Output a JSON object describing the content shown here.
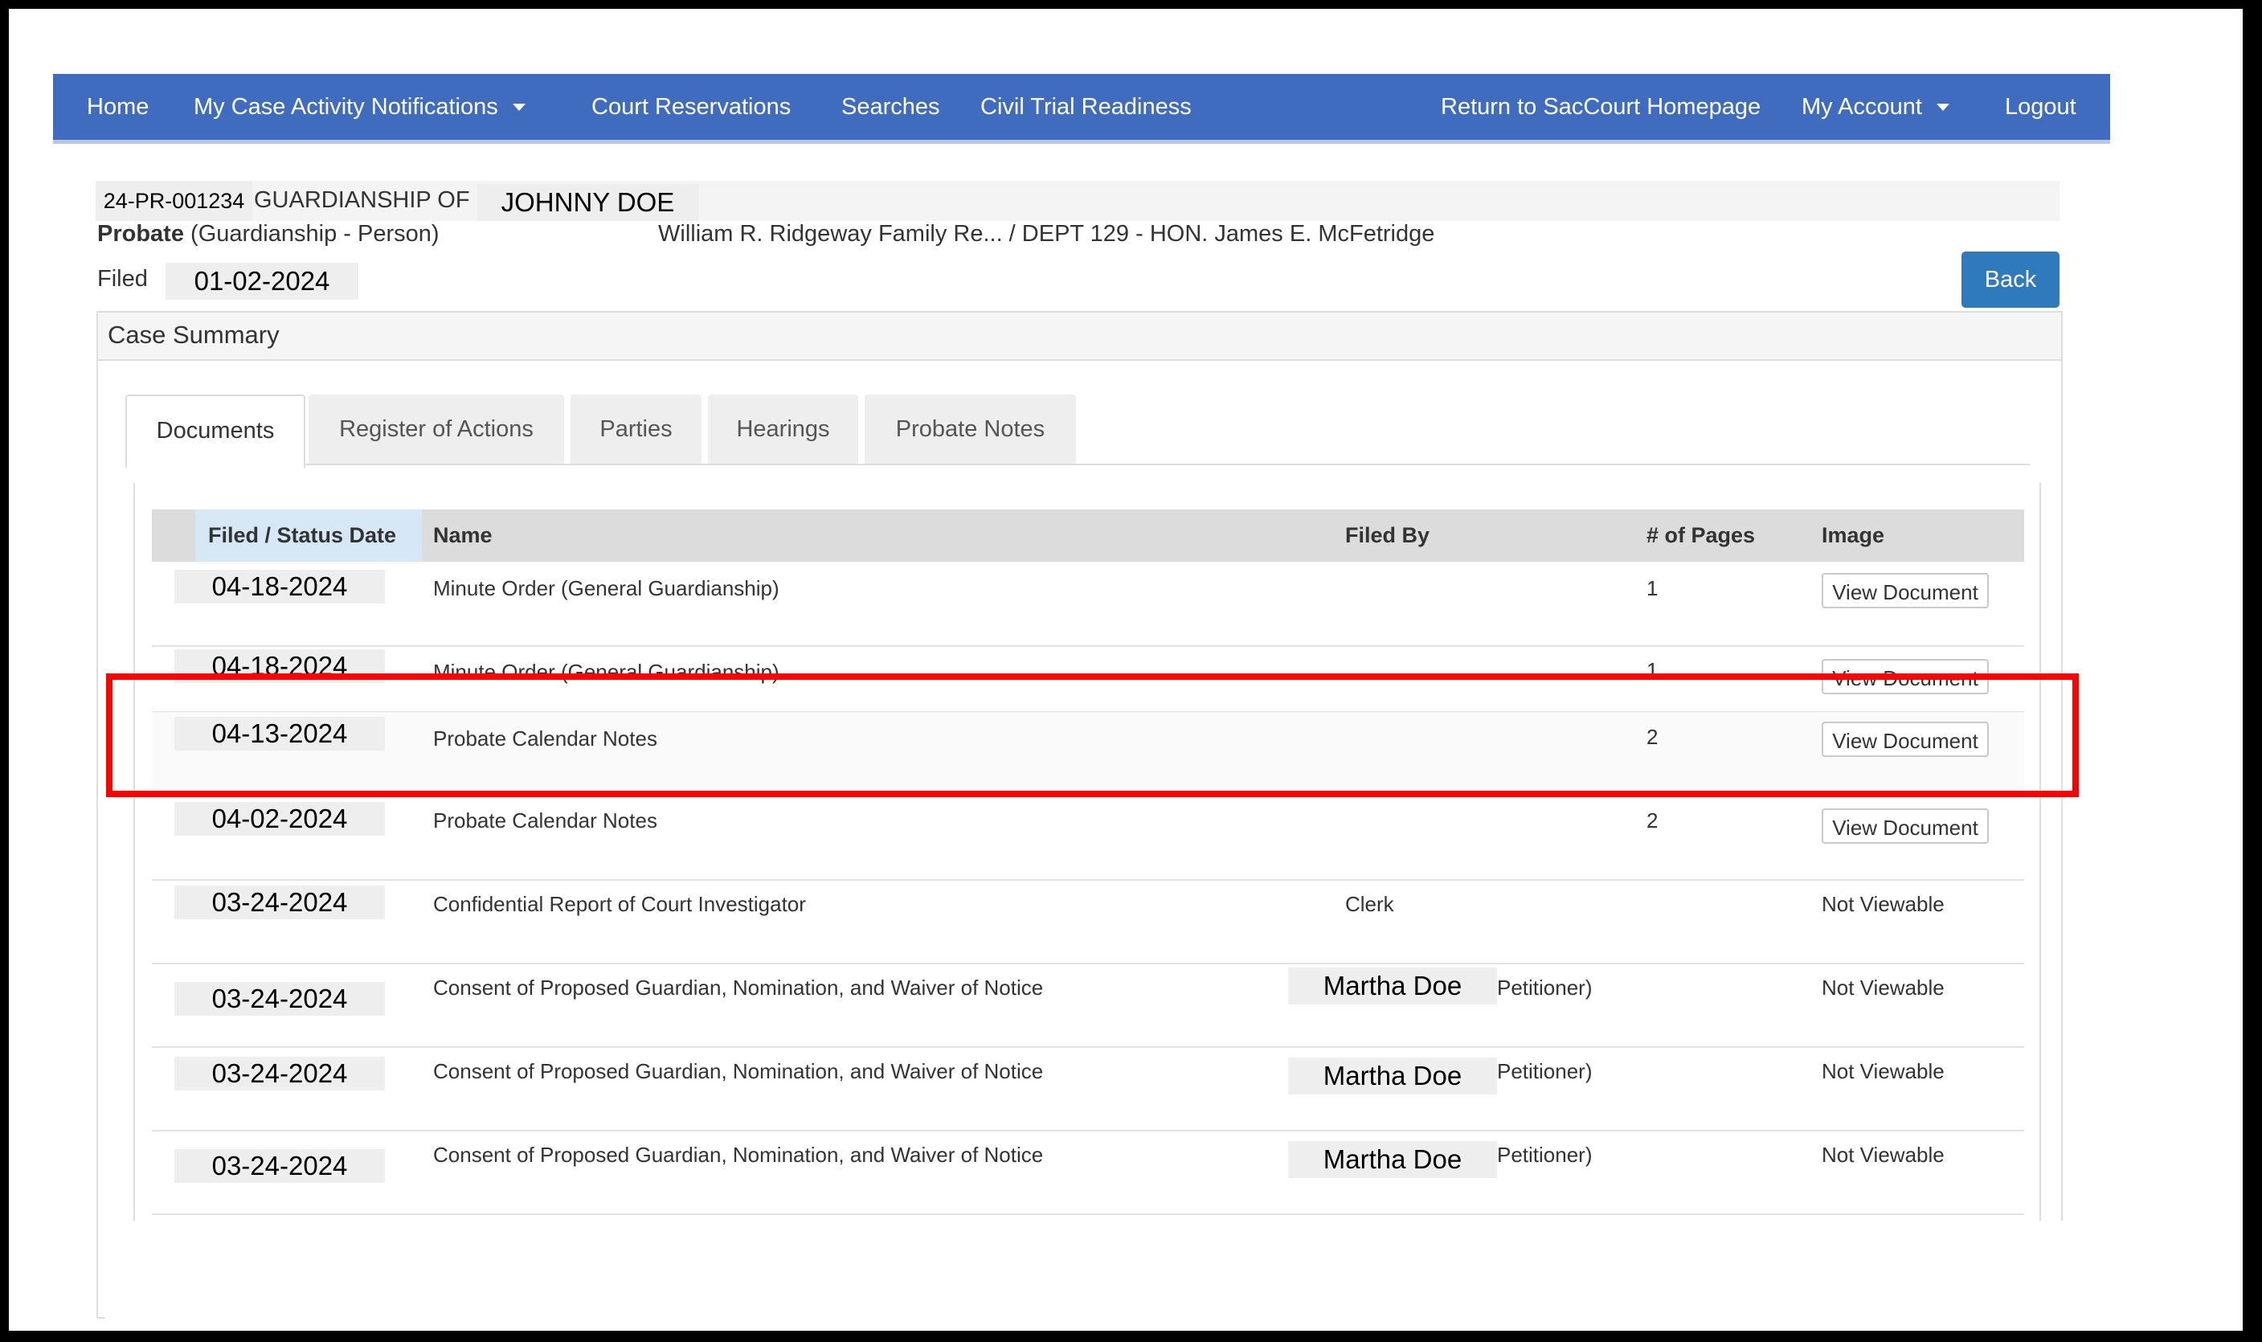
{
  "nav": {
    "home": "Home",
    "notifications": "My Case Activity Notifications",
    "reservations": "Court Reservations",
    "searches": "Searches",
    "readiness": "Civil Trial Readiness",
    "return_home": "Return to SacCourt Homepage",
    "my_account": "My Account",
    "logout": "Logout"
  },
  "case": {
    "number": "24-PR-001234",
    "title_prefix": "GUARDIANSHIP OF",
    "name": "JOHNNY DOE",
    "type_bold": "Probate",
    "type_rest": "(Guardianship - Person)",
    "location": "William R. Ridgeway Family Re... / DEPT 129 - HON. James E. McFetridge",
    "filed_label": "Filed",
    "filed_date": "01-02-2024",
    "back_label": "Back"
  },
  "panel": {
    "title": "Case Summary"
  },
  "tabs": [
    "Documents",
    "Register of Actions",
    "Parties",
    "Hearings",
    "Probate Notes"
  ],
  "table": {
    "headers": {
      "date": "Filed / Status Date",
      "name": "Name",
      "filed_by": "Filed By",
      "pages": "# of Pages",
      "image": "Image"
    },
    "rows": [
      {
        "date": "04-18-2024",
        "name": "Minute Order (General Guardianship)",
        "filed_by": "",
        "pages": "1",
        "image": "View Document"
      },
      {
        "date": "04-18-2024",
        "name": "Minute Order (General Guardianship)",
        "filed_by": "",
        "pages": "1",
        "image": "View Document"
      },
      {
        "date": "04-13-2024",
        "name": "Probate Calendar Notes",
        "filed_by": "",
        "pages": "2",
        "image": "View Document"
      },
      {
        "date": "04-02-2024",
        "name": "Probate Calendar Notes",
        "filed_by": "",
        "pages": "2",
        "image": "View Document"
      },
      {
        "date": "03-24-2024",
        "name": "Confidential Report of Court Investigator",
        "filed_by": "Clerk",
        "pages": "",
        "image": "Not Viewable"
      },
      {
        "date": "03-24-2024",
        "name": "Consent of Proposed Guardian, Nomination, and Waiver of Notice",
        "filed_by": "Martha Doe",
        "filed_by_suffix": "Petitioner)",
        "pages": "",
        "image": "Not Viewable"
      },
      {
        "date": "03-24-2024",
        "name": "Consent of Proposed Guardian, Nomination, and Waiver of Notice",
        "filed_by": "Martha Doe",
        "filed_by_suffix": "Petitioner)",
        "pages": "",
        "image": "Not Viewable"
      },
      {
        "date": "03-24-2024",
        "name": "Consent of Proposed Guardian, Nomination, and Waiver of Notice",
        "filed_by": "Martha Doe",
        "filed_by_suffix": "Petitioner)",
        "pages": "",
        "image": "Not Viewable"
      }
    ]
  },
  "colors": {
    "navbar": "#3f6cbf",
    "back_button": "#2f79bd",
    "highlight_box": "#ff0000"
  }
}
